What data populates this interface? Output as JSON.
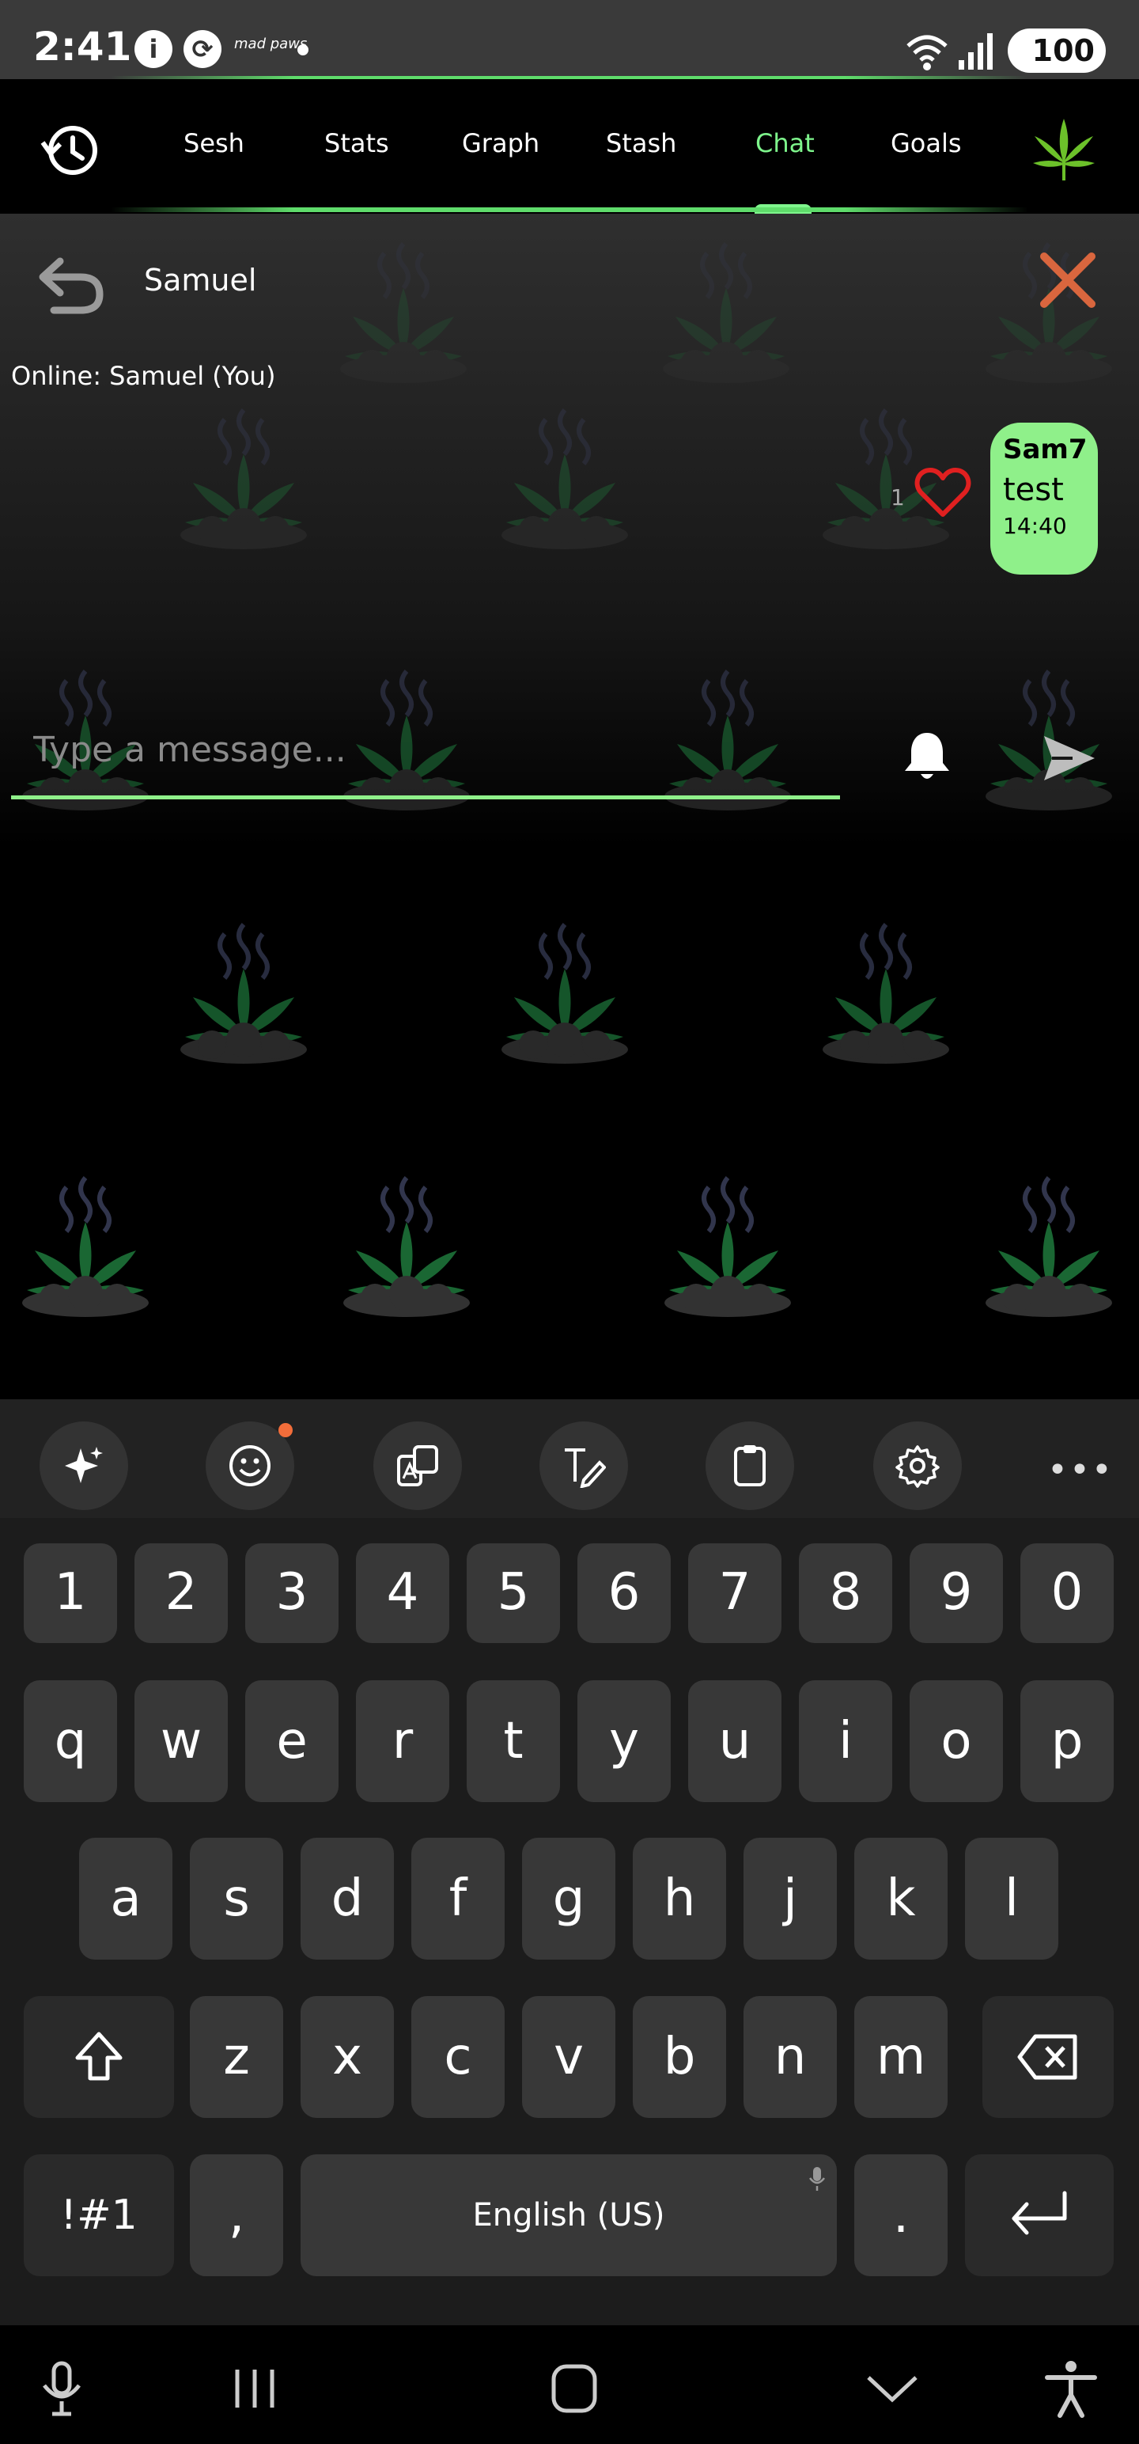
{
  "status_bar": {
    "time": "2:41",
    "app_label": "mad paws",
    "battery": "100"
  },
  "tabs": [
    {
      "label": "Sesh",
      "active": false
    },
    {
      "label": "Stats",
      "active": false
    },
    {
      "label": "Graph",
      "active": false
    },
    {
      "label": "Stash",
      "active": false
    },
    {
      "label": "Chat",
      "active": true
    },
    {
      "label": "Goals",
      "active": false
    }
  ],
  "chat": {
    "name": "Samuel",
    "online_text": "Online: Samuel (You)",
    "messages": [
      {
        "sender": "Sam7",
        "text": "test",
        "time": "14:40",
        "likes": "1"
      }
    ],
    "input_placeholder": "Type a message..."
  },
  "keyboard": {
    "toolbar": [
      "sparkle-icon",
      "emoji-icon",
      "translate-icon",
      "handwriting-icon",
      "clipboard-icon",
      "settings-icon",
      "more-icon"
    ],
    "number_row": [
      "1",
      "2",
      "3",
      "4",
      "5",
      "6",
      "7",
      "8",
      "9",
      "0"
    ],
    "row1": [
      "q",
      "w",
      "e",
      "r",
      "t",
      "y",
      "u",
      "i",
      "o",
      "p"
    ],
    "row2": [
      "a",
      "s",
      "d",
      "f",
      "g",
      "h",
      "j",
      "k",
      "l"
    ],
    "row3": [
      "z",
      "x",
      "c",
      "v",
      "b",
      "n",
      "m"
    ],
    "symbols_key": "!#1",
    "comma_key": ",",
    "space_label": "English (US)",
    "period_key": "."
  },
  "colors": {
    "accent": "#7ef58c",
    "bubble": "#8ff08a",
    "close": "#d9663e",
    "heart": "#e02020"
  }
}
